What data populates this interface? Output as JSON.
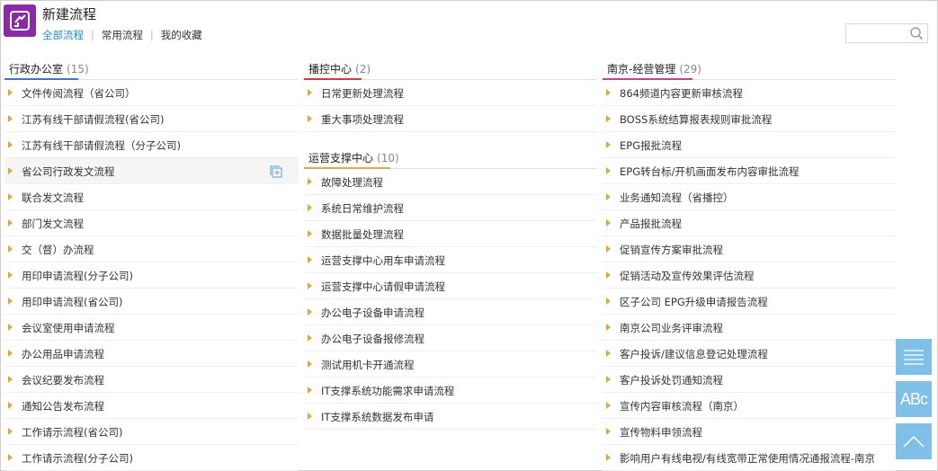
{
  "header": {
    "title": "新建流程",
    "tabs": [
      {
        "label": "全部流程",
        "active": true
      },
      {
        "label": "常用流程",
        "active": false
      },
      {
        "label": "我的收藏",
        "active": false
      }
    ],
    "search_placeholder": "",
    "accent_color": "#1a8ac8",
    "logo_color": "#8a2aa8"
  },
  "columns": [
    {
      "groups": [
        {
          "title": "行政办公室",
          "count": "(15)",
          "accent": "#3a78c8",
          "items": [
            "文件传阅流程（省公司）",
            "江苏有线干部请假流程(省公司)",
            "江苏有线干部请假流程（分子公司)",
            "省公司行政发文流程",
            "联合发文流程",
            "部门发文流程",
            "交（督）办流程",
            "用印申请流程(分子公司)",
            "用印申请流程(省公司)",
            "会议室使用申请流程",
            "办公用品申请流程",
            "会议纪要发布流程",
            "通知公告发布流程",
            "工作请示流程(省公司)",
            "工作请示流程(分子公司)"
          ]
        }
      ]
    },
    {
      "groups": [
        {
          "title": "播控中心",
          "count": "(2)",
          "accent": "#d23a3a",
          "items": [
            "日常更新处理流程",
            "重大事项处理流程"
          ]
        },
        {
          "title": "运营支撑中心",
          "count": "(10)",
          "accent": "#f0a050",
          "items": [
            "故障处理流程",
            "系统日常维护流程",
            "数据批量处理流程",
            "运营支撑中心用车申请流程",
            "运营支撑中心请假申请流程",
            "办公电子设备申请流程",
            "办公电子设备报修流程",
            "测试用机卡开通流程",
            "IT支撑系统功能需求申请流程",
            "IT支撑系统数据发布申请"
          ]
        }
      ]
    },
    {
      "groups": [
        {
          "title": "南京-经营管理",
          "count": "(29)",
          "accent": "#c040a0",
          "items": [
            "864频道内容更新审核流程",
            "BOSS系统结算报表规则审批流程",
            "EPG报批流程",
            "EPG转台标/开机画面发布内容审批流程",
            "业务通知流程（省播控）",
            "产品报批流程",
            "促销宣传方案审批流程",
            "促销活动及宣传效果评估流程",
            "区子公司 EPG升级申请报告流程",
            "南京公司业务评审流程",
            "客户投诉/建议信息登记处理流程",
            "客户投诉处罚通知流程",
            "宣传内容审核流程（南京）",
            "宣传物料申领流程",
            "影响用户有线电视/有线宽带正常使用情况通报流程-南京"
          ]
        }
      ]
    }
  ],
  "floating_buttons": {
    "menu_icon": "menu-lines-icon",
    "font_label": "ABc",
    "top_icon": "chevron-up-icon",
    "color": "#7fbfe8"
  }
}
